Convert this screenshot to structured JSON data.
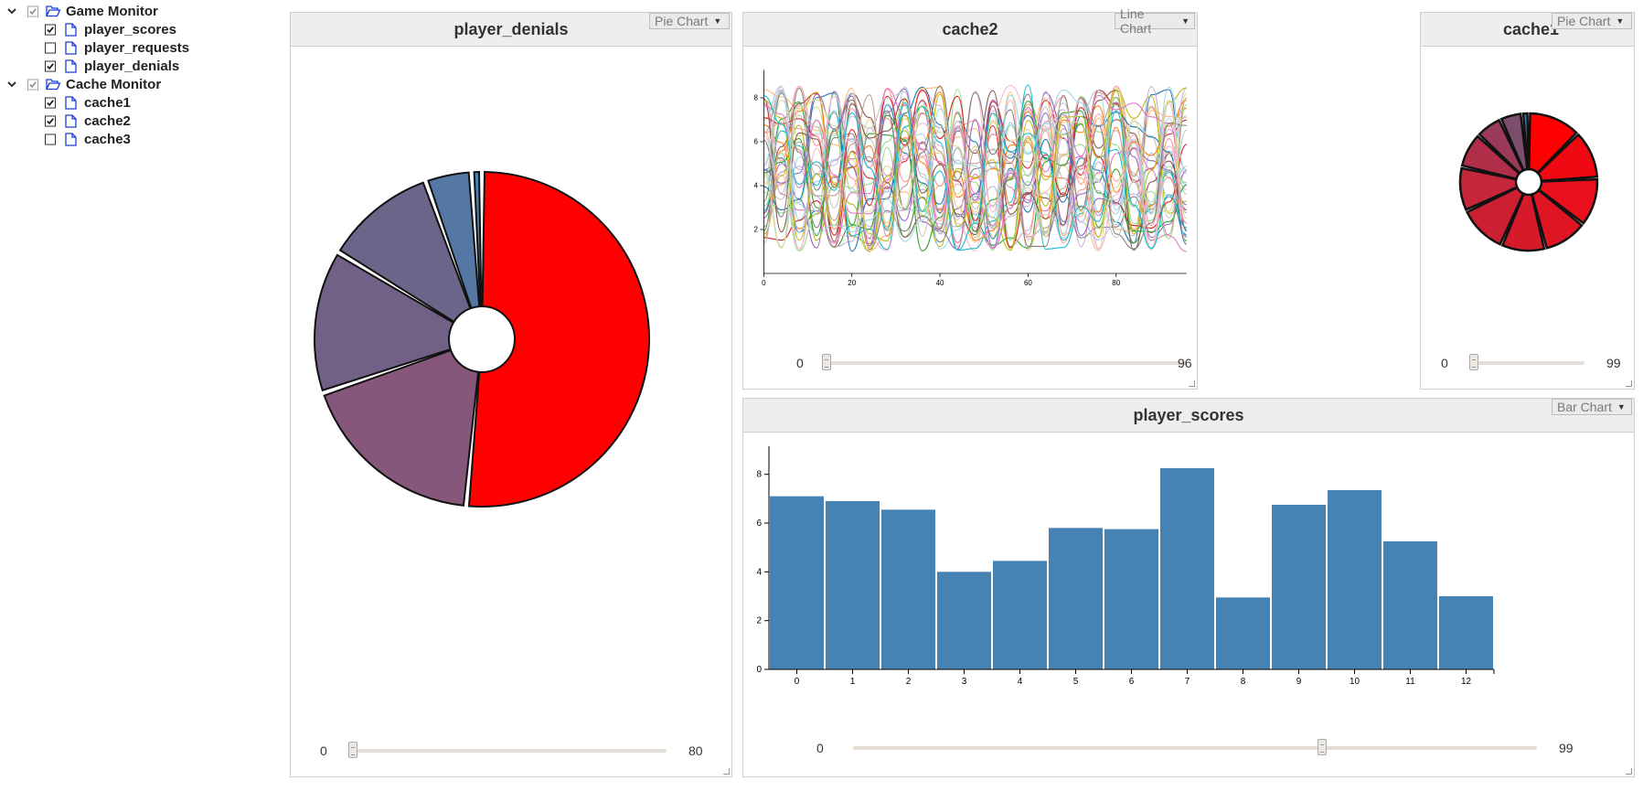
{
  "tree": {
    "groups": [
      {
        "label": "Game Monitor",
        "items": [
          {
            "label": "player_scores",
            "checked": true
          },
          {
            "label": "player_requests",
            "checked": false
          },
          {
            "label": "player_denials",
            "checked": true
          }
        ]
      },
      {
        "label": "Cache Monitor",
        "items": [
          {
            "label": "cache1",
            "checked": true
          },
          {
            "label": "cache2",
            "checked": true
          },
          {
            "label": "cache3",
            "checked": false
          }
        ]
      }
    ]
  },
  "panels": {
    "player_denials": {
      "title": "player_denials",
      "type": "Pie Chart",
      "slider_min": "0",
      "slider_max": "80",
      "slider_value": 0
    },
    "cache2": {
      "title": "cache2",
      "type": "Line Chart",
      "slider_min": "0",
      "slider_max": "96",
      "slider_value": 0
    },
    "cache1": {
      "title": "cache1",
      "type": "Pie Chart",
      "slider_min": "0",
      "slider_max": "99",
      "slider_value": 0
    },
    "player_scores": {
      "title": "player_scores",
      "type": "Bar Chart",
      "slider_min": "0",
      "slider_max": "99",
      "slider_value": 69
    }
  },
  "colors": {
    "bar": "#4682b4",
    "pie_stroke": "#111111",
    "panel_header": "#eeeeee"
  },
  "chart_data": [
    {
      "id": "player_denials",
      "type": "pie",
      "donut": true,
      "values": [
        52,
        18.5,
        14,
        11,
        4.5,
        1
      ],
      "colors": [
        "#ff0000",
        "#86577a",
        "#726186",
        "#6b658a",
        "#5577a4",
        "#4682b4"
      ]
    },
    {
      "id": "cache2",
      "type": "line",
      "series_count": 40,
      "x_range": [
        0,
        96
      ],
      "xlim": [
        0,
        96
      ],
      "ylim": [
        0,
        9
      ],
      "xticks": [
        0,
        20,
        40,
        60,
        80
      ],
      "yticks": [
        2,
        4,
        6,
        8
      ]
    },
    {
      "id": "cache1",
      "type": "pie",
      "donut": true,
      "values": [
        12,
        11,
        11,
        10,
        10,
        11,
        10,
        8,
        6,
        5,
        1.5
      ],
      "colors": [
        "#ff0000",
        "#f00912",
        "#e8101c",
        "#df1523",
        "#d61a2a",
        "#cc2032",
        "#c6263a",
        "#b02e48",
        "#9a3a58",
        "#7d4d6e",
        "#4682b4"
      ]
    },
    {
      "id": "player_scores",
      "type": "bar",
      "categories": [
        "0",
        "1",
        "2",
        "3",
        "4",
        "5",
        "6",
        "7",
        "8",
        "9",
        "10",
        "11",
        "12"
      ],
      "values": [
        7.1,
        6.9,
        6.55,
        4.0,
        4.45,
        5.8,
        5.75,
        8.25,
        2.95,
        6.75,
        7.35,
        5.25,
        3.0
      ],
      "ylim": [
        0,
        9
      ],
      "yticks": [
        0,
        2,
        4,
        6,
        8
      ]
    }
  ]
}
